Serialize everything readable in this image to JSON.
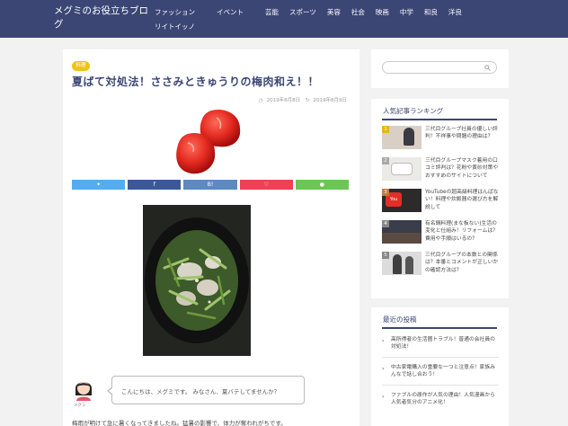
{
  "header": {
    "site_title": "メグミのお役立ちブログ",
    "nav": [
      "ファッション",
      "イベント",
      "芸能",
      "スポーツ",
      "美容",
      "社会",
      "映画",
      "中学",
      "和良",
      "洋良",
      "リイトイッノ"
    ]
  },
  "article": {
    "category": "料理",
    "title": "夏ばて対処法！ささみときゅうりの梅肉和え！！",
    "published": "2019年8月8日",
    "updated": "2019年8月9日",
    "share": [
      {
        "label": "",
        "icon": "twitter-icon",
        "color": "#55acee"
      },
      {
        "label": "f",
        "icon": "facebook-icon",
        "color": "#3b5998"
      },
      {
        "label": "B!",
        "icon": "hatena-icon",
        "color": "#5d8ac1"
      },
      {
        "label": "",
        "icon": "pocket-icon",
        "color": "#ef4056"
      },
      {
        "label": "",
        "icon": "line-icon",
        "color": "#6cc655"
      }
    ],
    "author_name": "メグミ",
    "greeting": "こんにちは、メグミです。 みなさん、夏バテしてませんか？",
    "body_snippet": "梅雨が明けて急に暑くなってきましたね。猛暑の影響で、体力が奪われがちです。"
  },
  "sidebar": {
    "search_placeholder": "",
    "ranking_title": "人気記事ランキング",
    "ranking": [
      {
        "rank": "1",
        "text": "三代目グループ社員の優しい評判！不祥事や問題の理由は？"
      },
      {
        "rank": "2",
        "text": "三代目グループマスク着用の口コミ評判は？花粉や黄砂対策やおすすめのサイトについて"
      },
      {
        "rank": "3",
        "text": "YouTubeの超高級料理はんぱない！料理や炊飯器の選び方を解説して"
      },
      {
        "rank": "4",
        "text": "有名鍋料理(まな板ない)生活の変化と仕組み！リフォームは？費用や手順はいるの？"
      },
      {
        "rank": "5",
        "text": "三代目グループの本数との関係は？本番とコメントが正しいかの確認方法は？"
      }
    ],
    "recent_title": "最近の投稿",
    "recent": [
      "高所得者の生活圏トラブル！普通の会社員の対処法！",
      "中古家電購入の重要な一つと注意点！家族みんなで話し合おう！",
      "ファブルの原作が人気の理由！人気漫画から人気者気分のアニメ化！"
    ]
  }
}
